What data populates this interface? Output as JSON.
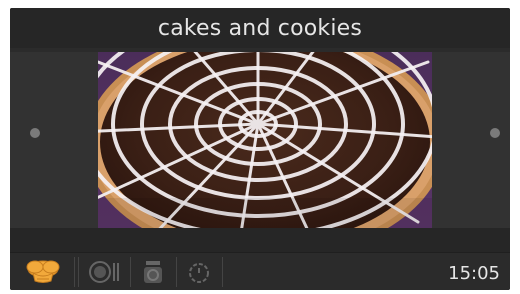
{
  "header": {
    "title": "cakes and cookies"
  },
  "carousel": {
    "image_icon": "spiderweb-cake-photo",
    "prev_icon": "dot-icon",
    "next_icon": "dot-icon"
  },
  "bottom_bar": {
    "icons": [
      "chef-hat-icon",
      "plate-fork-knife-icon",
      "weighing-scale-icon",
      "timer-icon"
    ],
    "time": "15:05"
  },
  "colors": {
    "screen_bg": "#2b2b2b",
    "title_bg": "#262626",
    "content_bg": "#323232",
    "accent_orange": "#f2a93b",
    "inactive_icon": "#666666"
  }
}
